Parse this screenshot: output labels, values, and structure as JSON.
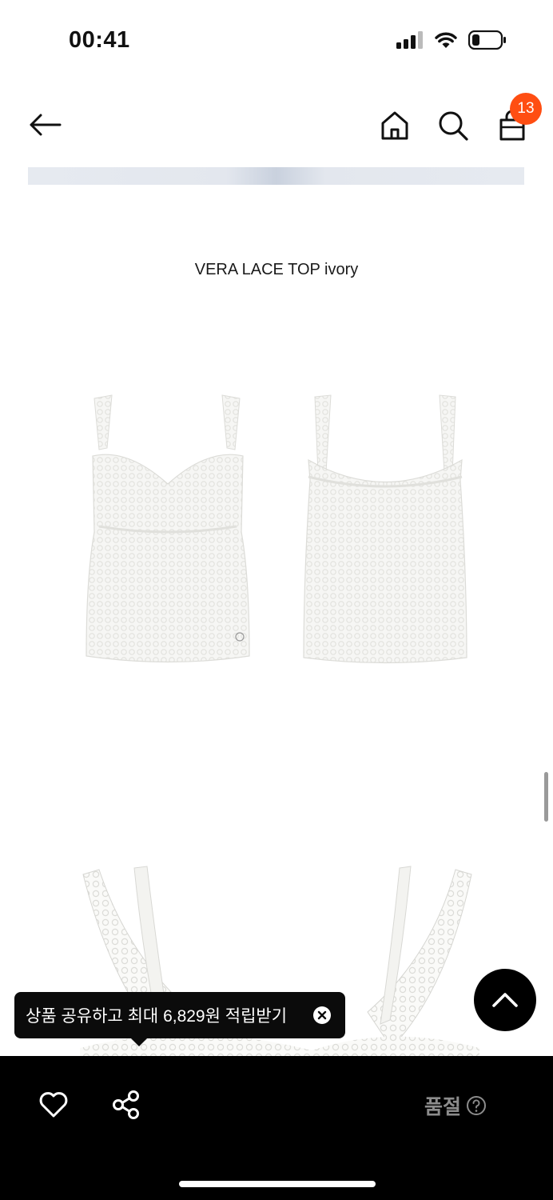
{
  "status_bar": {
    "time": "00:41"
  },
  "header": {
    "cart_count": "13"
  },
  "product": {
    "title": "VERA LACE TOP ivory"
  },
  "tooltip": {
    "text": "상품 공유하고 최대 6,829원 적립받기"
  },
  "bottom_bar": {
    "status_label": "품절"
  },
  "colors": {
    "badge": "#ff4e12",
    "bar": "#000000",
    "muted": "#8c8c8c"
  }
}
